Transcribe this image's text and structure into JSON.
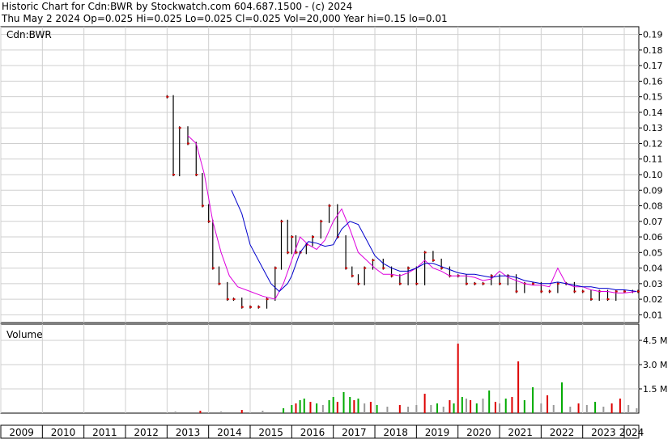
{
  "header": {
    "line1": "Historic Chart for Cdn:BWR by Stockwatch.com 604.687.1500 - (c) 2024",
    "line2": "Thu May  2 2024   Op=0.025  Hi=0.025  Lo=0.025  Cl=0.025  Vol=20,000  Year hi=0.15  lo=0.01"
  },
  "colors": {
    "price_bar": "#000000",
    "price_dot": "#cc0000",
    "ma_short": "#dd00dd",
    "ma_long": "#0000cc",
    "vol_up": "#00aa00",
    "vol_down": "#dd0000",
    "vol_flat": "#999999"
  },
  "chart_data": [
    {
      "type": "line",
      "title": "Cdn:BWR",
      "y_ticks": [
        "0.19",
        "0.18",
        "0.17",
        "0.16",
        "0.15",
        "0.14",
        "0.13",
        "0.12",
        "0.11",
        "0.10",
        "0.09",
        "0.08",
        "0.07",
        "0.06",
        "0.05",
        "0.04",
        "0.03",
        "0.02",
        "0.01"
      ],
      "ylim": [
        0.005,
        0.195
      ],
      "x_tick_labels": [
        "2009",
        "2010",
        "2011",
        "2012",
        "2013",
        "2014",
        "2015",
        "2016",
        "2017",
        "2018",
        "2019",
        "2020",
        "2021",
        "2022",
        "2023",
        "2024"
      ],
      "xlim": [
        2009.0,
        2024.35
      ],
      "grid": true,
      "series": [
        {
          "kind": "close",
          "x": [
            2013.0,
            2013.15,
            2013.3,
            2013.5,
            2013.7,
            2013.85,
            2014.0,
            2014.1,
            2014.25,
            2014.45,
            2014.6,
            2014.8,
            2015.0,
            2015.2,
            2015.4,
            2015.6,
            2015.75,
            2015.9,
            2016.0,
            2016.1,
            2016.2,
            2016.35,
            2016.5,
            2016.7,
            2016.9,
            2017.1,
            2017.3,
            2017.45,
            2017.6,
            2017.75,
            2017.95,
            2018.2,
            2018.4,
            2018.6,
            2018.8,
            2019.0,
            2019.2,
            2019.4,
            2019.6,
            2019.8,
            2020.0,
            2020.2,
            2020.4,
            2020.6,
            2020.8,
            2021.0,
            2021.2,
            2021.4,
            2021.6,
            2021.8,
            2022.0,
            2022.2,
            2022.4,
            2022.6,
            2022.8,
            2023.0,
            2023.2,
            2023.4,
            2023.6,
            2023.8,
            2024.0,
            2024.2,
            2024.33
          ],
          "y": [
            0.15,
            0.1,
            0.13,
            0.12,
            0.1,
            0.08,
            0.07,
            0.04,
            0.03,
            0.02,
            0.02,
            0.015,
            0.015,
            0.015,
            0.02,
            0.04,
            0.07,
            0.05,
            0.06,
            0.05,
            0.05,
            0.055,
            0.06,
            0.07,
            0.08,
            0.06,
            0.04,
            0.035,
            0.03,
            0.04,
            0.045,
            0.04,
            0.035,
            0.03,
            0.04,
            0.03,
            0.05,
            0.045,
            0.04,
            0.035,
            0.035,
            0.03,
            0.03,
            0.03,
            0.035,
            0.03,
            0.035,
            0.025,
            0.03,
            0.03,
            0.025,
            0.025,
            0.03,
            0.03,
            0.025,
            0.025,
            0.02,
            0.025,
            0.02,
            0.025,
            0.025,
            0.025,
            0.025
          ]
        },
        {
          "kind": "ma_short",
          "x": [
            2013.5,
            2013.7,
            2013.9,
            2014.1,
            2014.3,
            2014.5,
            2014.7,
            2015.0,
            2015.3,
            2015.6,
            2015.8,
            2016.0,
            2016.2,
            2016.4,
            2016.6,
            2016.8,
            2017.0,
            2017.2,
            2017.4,
            2017.6,
            2017.8,
            2018.0,
            2018.2,
            2018.4,
            2018.6,
            2018.8,
            2019.0,
            2019.2,
            2019.4,
            2019.6,
            2019.8,
            2020.0,
            2020.2,
            2020.4,
            2020.6,
            2020.8,
            2021.0,
            2021.2,
            2021.4,
            2021.6,
            2021.8,
            2022.0,
            2022.2,
            2022.4,
            2022.6,
            2022.8,
            2023.0,
            2023.2,
            2023.4,
            2023.6,
            2023.8,
            2024.0,
            2024.3
          ],
          "y": [
            0.125,
            0.12,
            0.1,
            0.07,
            0.05,
            0.035,
            0.028,
            0.025,
            0.022,
            0.02,
            0.03,
            0.045,
            0.06,
            0.055,
            0.052,
            0.058,
            0.07,
            0.078,
            0.065,
            0.05,
            0.045,
            0.04,
            0.036,
            0.036,
            0.035,
            0.037,
            0.04,
            0.045,
            0.04,
            0.038,
            0.035,
            0.035,
            0.035,
            0.034,
            0.032,
            0.033,
            0.038,
            0.034,
            0.032,
            0.03,
            0.029,
            0.029,
            0.028,
            0.04,
            0.03,
            0.028,
            0.028,
            0.026,
            0.025,
            0.025,
            0.024,
            0.024,
            0.025
          ]
        },
        {
          "kind": "ma_long",
          "x": [
            2014.55,
            2014.8,
            2015.0,
            2015.3,
            2015.5,
            2015.7,
            2015.9,
            2016.0,
            2016.2,
            2016.4,
            2016.6,
            2016.8,
            2017.0,
            2017.2,
            2017.4,
            2017.6,
            2017.8,
            2018.0,
            2018.2,
            2018.4,
            2018.6,
            2018.8,
            2019.0,
            2019.2,
            2019.4,
            2019.6,
            2019.8,
            2020.0,
            2020.2,
            2020.4,
            2020.6,
            2020.8,
            2021.0,
            2021.2,
            2021.4,
            2021.6,
            2021.8,
            2022.0,
            2022.2,
            2022.4,
            2022.6,
            2022.8,
            2023.0,
            2023.2,
            2023.4,
            2023.6,
            2023.8,
            2024.0,
            2024.3
          ],
          "y": [
            0.09,
            0.075,
            0.055,
            0.04,
            0.03,
            0.025,
            0.03,
            0.035,
            0.05,
            0.057,
            0.056,
            0.054,
            0.055,
            0.065,
            0.07,
            0.068,
            0.058,
            0.048,
            0.043,
            0.04,
            0.038,
            0.038,
            0.04,
            0.043,
            0.043,
            0.041,
            0.039,
            0.037,
            0.036,
            0.036,
            0.035,
            0.034,
            0.035,
            0.035,
            0.034,
            0.032,
            0.031,
            0.03,
            0.03,
            0.031,
            0.03,
            0.029,
            0.028,
            0.028,
            0.027,
            0.027,
            0.026,
            0.026,
            0.025
          ]
        }
      ]
    },
    {
      "type": "bar",
      "title": "Volume",
      "y_ticks": [
        "4.5 M",
        "3.0 M",
        "1.5 M"
      ],
      "ylim": [
        0,
        5.5
      ],
      "unit": "M",
      "x": [
        2013.2,
        2013.8,
        2014.3,
        2014.8,
        2015.3,
        2015.8,
        2016.0,
        2016.1,
        2016.2,
        2016.3,
        2016.45,
        2016.6,
        2016.75,
        2016.9,
        2017.0,
        2017.1,
        2017.25,
        2017.4,
        2017.5,
        2017.6,
        2017.75,
        2017.9,
        2018.05,
        2018.3,
        2018.6,
        2018.8,
        2019.0,
        2019.2,
        2019.35,
        2019.5,
        2019.65,
        2019.8,
        2019.9,
        2020.0,
        2020.1,
        2020.2,
        2020.3,
        2020.45,
        2020.6,
        2020.75,
        2020.9,
        2021.0,
        2021.15,
        2021.3,
        2021.45,
        2021.6,
        2021.8,
        2022.0,
        2022.15,
        2022.3,
        2022.5,
        2022.7,
        2022.9,
        2023.1,
        2023.3,
        2023.5,
        2023.7,
        2023.9,
        2024.1,
        2024.3
      ],
      "values": [
        0.1,
        0.15,
        0.1,
        0.2,
        0.15,
        0.3,
        0.5,
        0.6,
        0.8,
        0.9,
        0.7,
        0.6,
        0.5,
        0.8,
        1.0,
        0.7,
        1.3,
        1.0,
        0.8,
        0.9,
        0.6,
        0.7,
        0.5,
        0.4,
        0.5,
        0.4,
        0.5,
        1.2,
        0.5,
        0.6,
        0.4,
        0.8,
        0.6,
        4.3,
        1.0,
        0.9,
        0.8,
        0.6,
        0.9,
        1.4,
        0.7,
        0.6,
        0.9,
        1.0,
        3.2,
        0.8,
        1.6,
        0.6,
        1.1,
        0.5,
        1.9,
        0.4,
        0.6,
        0.5,
        0.7,
        0.4,
        0.6,
        0.9,
        0.5,
        0.3
      ],
      "direction": [
        "flat",
        "down",
        "flat",
        "down",
        "flat",
        "up",
        "up",
        "down",
        "up",
        "up",
        "down",
        "up",
        "flat",
        "up",
        "up",
        "down",
        "up",
        "up",
        "down",
        "up",
        "flat",
        "down",
        "up",
        "flat",
        "down",
        "flat",
        "flat",
        "down",
        "flat",
        "up",
        "flat",
        "down",
        "up",
        "down",
        "up",
        "flat",
        "down",
        "up",
        "flat",
        "up",
        "down",
        "flat",
        "up",
        "down",
        "down",
        "up",
        "up",
        "flat",
        "down",
        "flat",
        "up",
        "flat",
        "down",
        "flat",
        "up",
        "flat",
        "down",
        "down",
        "flat",
        "flat"
      ]
    }
  ]
}
